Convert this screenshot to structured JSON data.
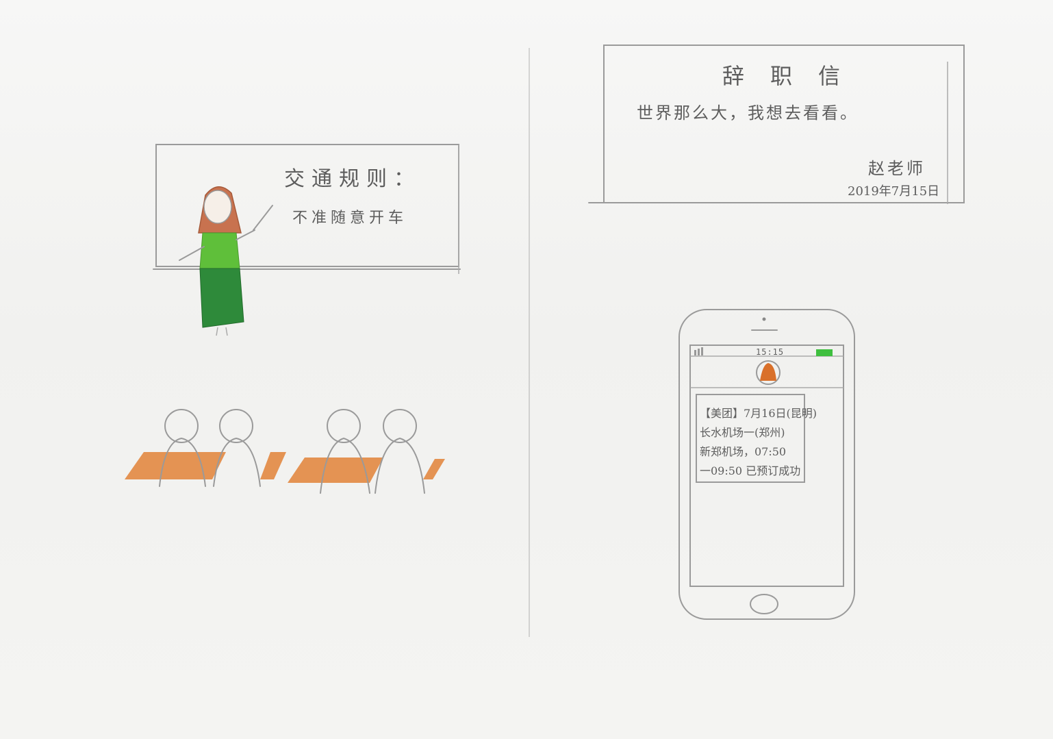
{
  "chalkboard": {
    "title": "交通规则：",
    "rule": "不准随意开车"
  },
  "resignation_letter": {
    "title": "辞职信",
    "body": "世界那么大，我想去看看。",
    "signature": "赵老师",
    "date": "2019年7月15日"
  },
  "phone": {
    "status_time": "15:15",
    "sms_lines": [
      "【美团】7月16日(昆明)",
      "长水机场一(郑州)",
      "新郑机场，07:50",
      "一09:50 已预订成功"
    ]
  },
  "colors": {
    "dress_top": "#5fbf3a",
    "skirt": "#2e8a3a",
    "hair": "#c8724f",
    "desk": "#e07a2c",
    "avatar": "#d9702a",
    "battery": "#3fbf3f"
  }
}
